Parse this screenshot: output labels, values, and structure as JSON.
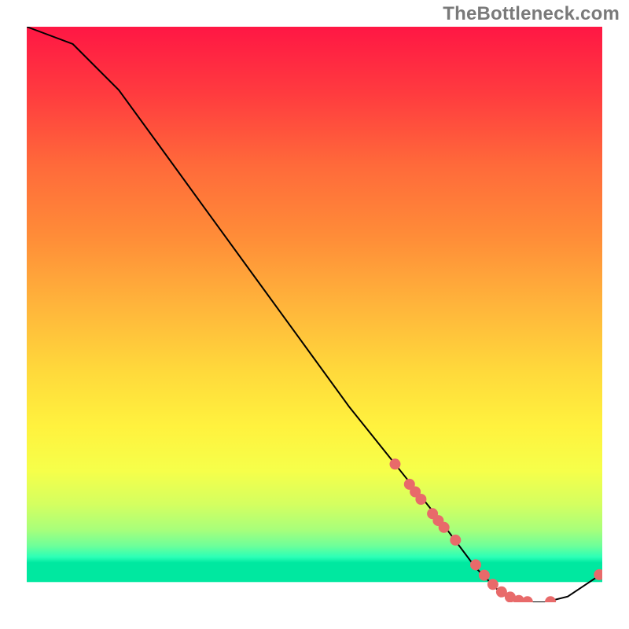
{
  "watermark": "TheBottleneck.com",
  "chart_data": {
    "type": "line",
    "title": "",
    "xlabel": "",
    "ylabel": "",
    "xlim": [
      0,
      100
    ],
    "ylim": [
      0,
      100
    ],
    "grid": false,
    "curve": {
      "x": [
        0,
        8,
        16,
        24,
        32,
        40,
        48,
        56,
        64,
        72,
        78,
        82,
        86,
        90,
        94,
        100
      ],
      "y": [
        100,
        97,
        89,
        78,
        67,
        56,
        45,
        34,
        24,
        14,
        6,
        2,
        0,
        0,
        1,
        5
      ]
    },
    "markers": {
      "x": [
        64,
        66.5,
        67.5,
        68.5,
        70.5,
        71.5,
        72.5,
        74.5,
        78,
        79.5,
        81,
        82.5,
        84,
        85.5,
        87,
        91,
        99.5
      ],
      "y": [
        24,
        20.5,
        19.2,
        17.9,
        15.4,
        14.2,
        13.0,
        10.8,
        6.5,
        4.7,
        3.1,
        1.8,
        0.9,
        0.3,
        0.1,
        0.1,
        4.8
      ]
    },
    "gradient_stops": [
      {
        "offset": 0.0,
        "color": "#ff1744"
      },
      {
        "offset": 0.12,
        "color": "#ff3b3f"
      },
      {
        "offset": 0.25,
        "color": "#ff6a3a"
      },
      {
        "offset": 0.38,
        "color": "#ff8d38"
      },
      {
        "offset": 0.5,
        "color": "#ffb43b"
      },
      {
        "offset": 0.62,
        "color": "#ffd93b"
      },
      {
        "offset": 0.72,
        "color": "#fff23e"
      },
      {
        "offset": 0.8,
        "color": "#f6ff4a"
      },
      {
        "offset": 0.86,
        "color": "#d4ff60"
      },
      {
        "offset": 0.905,
        "color": "#a9ff7a"
      },
      {
        "offset": 0.935,
        "color": "#6dff9a"
      },
      {
        "offset": 0.955,
        "color": "#2bffb7"
      },
      {
        "offset": 0.965,
        "color": "#00e8a0"
      }
    ],
    "marker_color": "#e86a6a",
    "plot_frame_color": "#ffffff",
    "plot_bg_below": "#ffffff"
  }
}
